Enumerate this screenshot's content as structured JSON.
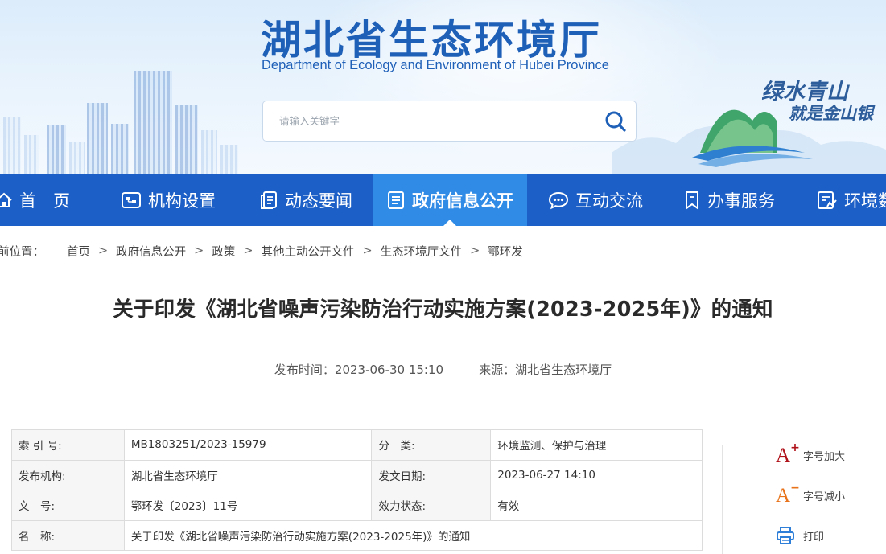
{
  "header": {
    "title": "湖北省生态环境厅",
    "subtitle": "Department of Ecology and Environment of Hubei Province",
    "search_placeholder": "请输入关键字",
    "slogan_line1": "绿水青山",
    "slogan_line2": "就是金山银"
  },
  "nav": {
    "items": [
      {
        "label": "首　页",
        "icon": "home-icon"
      },
      {
        "label": "机构设置",
        "icon": "org-chart-icon"
      },
      {
        "label": "动态要闻",
        "icon": "news-icon"
      },
      {
        "label": "政府信息公开",
        "icon": "document-list-icon",
        "active": true
      },
      {
        "label": "互动交流",
        "icon": "chat-bubble-icon"
      },
      {
        "label": "办事服务",
        "icon": "bookmark-icon"
      },
      {
        "label": "环境数",
        "icon": "data-chart-icon"
      }
    ]
  },
  "breadcrumb": {
    "lead": "前位置：",
    "items": [
      "首页",
      "政府信息公开",
      "政策",
      "其他主动公开文件",
      "生态环境厅文件",
      "鄂环发"
    ],
    "separator": ">"
  },
  "article": {
    "title": "关于印发《湖北省噪声污染防治行动实施方案(2023-2025年)》的通知",
    "publish_label": "发布时间：",
    "publish_time": "2023-06-30 15:10",
    "source_label": "来源：",
    "source": "湖北省生态环境厅"
  },
  "info_table": {
    "rows": [
      [
        "索 引 号:",
        "MB1803251/2023-15979",
        "分　类:",
        "环境监测、保护与治理"
      ],
      [
        "发布机构:",
        "湖北省生态环境厅",
        "发文日期:",
        "2023-06-27 14:10"
      ],
      [
        "文　号:",
        "鄂环发〔2023〕11号",
        "效力状态:",
        "有效"
      ],
      [
        "名　称:",
        "关于印发《湖北省噪声污染防治行动实施方案(2023-2025年)》的通知"
      ]
    ]
  },
  "tools": {
    "font_increase_label": "字号加大",
    "font_decrease_label": "字号减小",
    "print_label": "打印",
    "increase_glyph": "A",
    "increase_sign": "+",
    "decrease_glyph": "A",
    "decrease_sign": "−",
    "increase_color": "#b0121a",
    "decrease_color": "#e8731a",
    "print_color": "#2f7fd8"
  },
  "colors": {
    "nav_bg": "#1c5fc6",
    "nav_active": "#2f8be6",
    "brand_blue": "#1e5fb8"
  }
}
